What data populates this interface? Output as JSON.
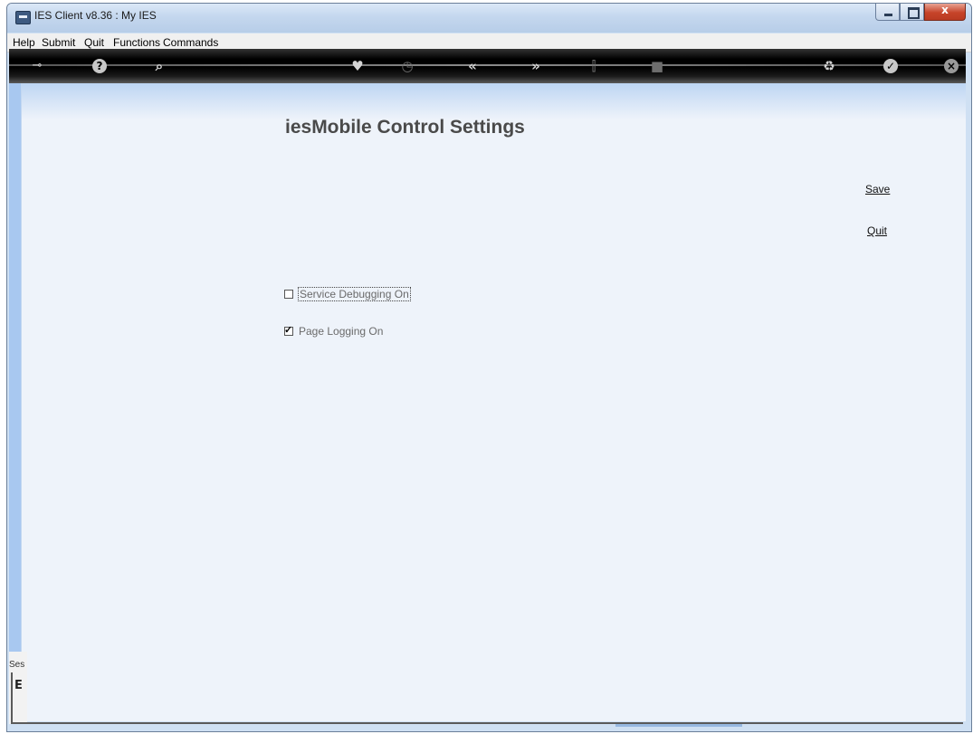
{
  "window": {
    "title": "IES Client v8.36 : My IES",
    "buttons": {
      "minimize": "minimize",
      "maximize": "maximize",
      "close": "x"
    }
  },
  "menu": [
    "Help",
    "Submit",
    "Quit",
    "Functions",
    "Commands"
  ],
  "toolbar": {
    "icons": [
      "key-icon",
      "help-icon",
      "search-icon",
      "heart-icon",
      "clock-icon",
      "back-icon",
      "forward-icon",
      "tools-icon",
      "stop-icon",
      "recycle-icon",
      "check-icon",
      "close-icon"
    ]
  },
  "page": {
    "title": "iesMobile Control Settings",
    "save_label": "Save",
    "quit_label": "Quit",
    "options": [
      {
        "label": "Service Debugging On",
        "checked": false
      },
      {
        "label": "Page Logging On",
        "checked": true
      }
    ]
  },
  "status": {
    "session_label": "Ses",
    "glyph": "E"
  },
  "colors": {
    "content_bg": "#eef3fa",
    "sidebar": "#a8c8f0",
    "toolbar": "#000000",
    "title_text": "#4a4a4a"
  }
}
